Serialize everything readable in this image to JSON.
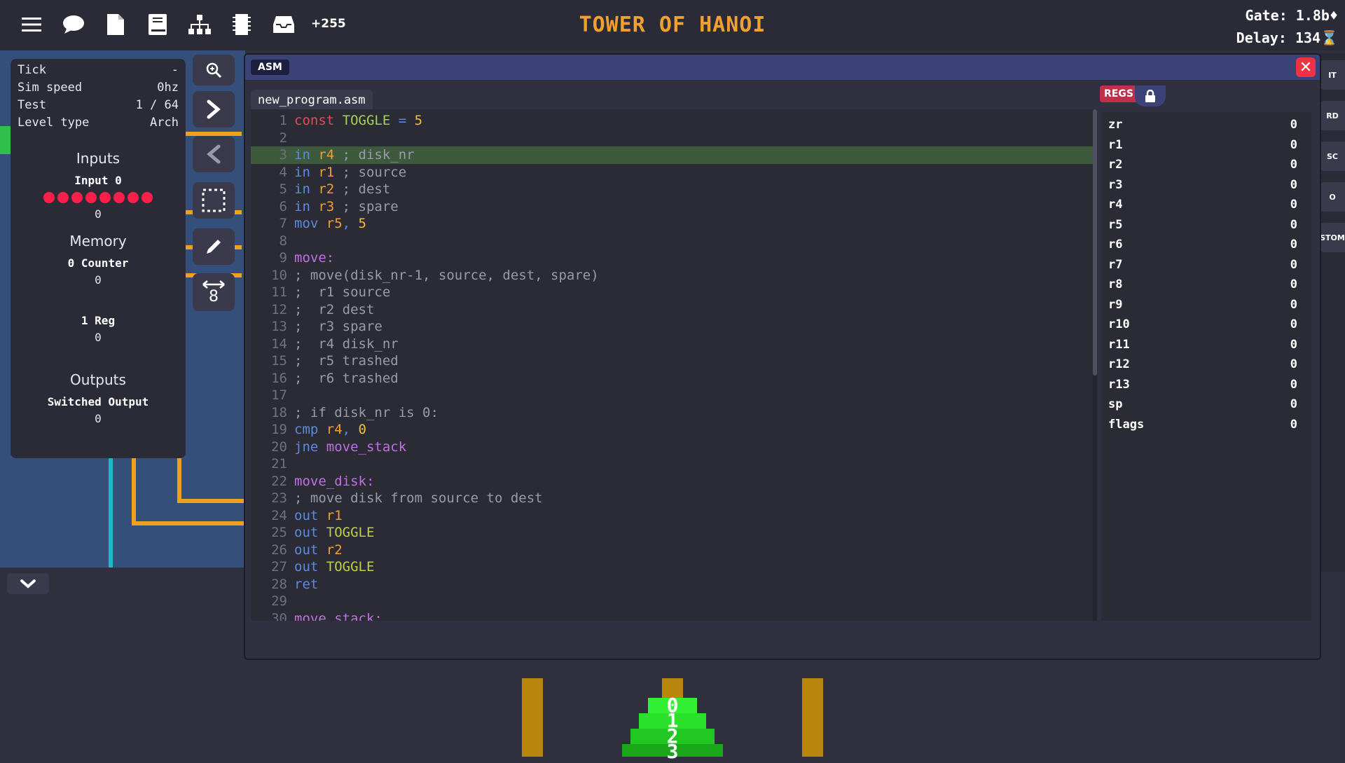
{
  "topbar": {
    "menu_icon": "hamburger-icon",
    "chat_icon": "speech-bubble-icon",
    "file_icon": "document-icon",
    "book_icon": "book-icon",
    "hierarchy_icon": "hierarchy-icon",
    "chip_icon": "chip-icon",
    "inbox_icon": "inbox-icon",
    "extra_count": "+255",
    "title": "TOWER OF HANOI",
    "gate": "Gate: 1.8b",
    "delay": "Delay: 134"
  },
  "info": {
    "tick_label": "Tick",
    "tick_value": "-",
    "speed_label": "Sim speed",
    "speed_value": "0hz",
    "test_label": "Test",
    "test_value": "1 / 64",
    "level_label": "Level type",
    "level_value": "Arch",
    "inputs_title": "Inputs",
    "input0_label": "Input 0",
    "input0_value": "0",
    "input_bits": 8,
    "memory_title": "Memory",
    "counter_label": "0 Counter",
    "counter_value": "0",
    "reg_label": "1 Reg",
    "reg_value": "0",
    "outputs_title": "Outputs",
    "switched_label": "Switched Output",
    "switched_value": "0"
  },
  "tools": {
    "zoom_icon": "zoom-icon",
    "next_icon": "chevron-right-icon",
    "prev_icon": "chevron-left-icon",
    "select_icon": "selection-icon",
    "pencil_icon": "pencil-icon",
    "width_value": "8"
  },
  "asm": {
    "badge": "ASM",
    "close": "✕",
    "filename": "new_program.asm",
    "regs_badge": "REGS",
    "lines": [
      {
        "n": "1",
        "tokens": [
          [
            "kw",
            "const "
          ],
          [
            "name",
            "TOGGLE "
          ],
          [
            "op",
            "= "
          ],
          [
            "num",
            "5"
          ]
        ]
      },
      {
        "n": "2",
        "tokens": []
      },
      {
        "n": "3",
        "tokens": [
          [
            "ins",
            "in "
          ],
          [
            "reg",
            "r4 "
          ],
          [
            "comment",
            "; disk_nr"
          ]
        ],
        "active": true
      },
      {
        "n": "4",
        "tokens": [
          [
            "ins",
            "in "
          ],
          [
            "reg",
            "r1 "
          ],
          [
            "comment",
            "; source"
          ]
        ]
      },
      {
        "n": "5",
        "tokens": [
          [
            "ins",
            "in "
          ],
          [
            "reg",
            "r2 "
          ],
          [
            "comment",
            "; dest"
          ]
        ]
      },
      {
        "n": "6",
        "tokens": [
          [
            "ins",
            "in "
          ],
          [
            "reg",
            "r3 "
          ],
          [
            "comment",
            "; spare"
          ]
        ]
      },
      {
        "n": "7",
        "tokens": [
          [
            "ins",
            "mov "
          ],
          [
            "reg",
            "r5"
          ],
          [
            "op",
            ", "
          ],
          [
            "num",
            "5"
          ]
        ]
      },
      {
        "n": "8",
        "tokens": []
      },
      {
        "n": "9",
        "tokens": [
          [
            "label",
            "move:"
          ]
        ]
      },
      {
        "n": "10",
        "tokens": [
          [
            "comment",
            "; move(disk_nr-1, source, dest, spare)"
          ]
        ]
      },
      {
        "n": "11",
        "tokens": [
          [
            "comment",
            ";  r1 source"
          ]
        ]
      },
      {
        "n": "12",
        "tokens": [
          [
            "comment",
            ";  r2 dest"
          ]
        ]
      },
      {
        "n": "13",
        "tokens": [
          [
            "comment",
            ";  r3 spare"
          ]
        ]
      },
      {
        "n": "14",
        "tokens": [
          [
            "comment",
            ";  r4 disk_nr"
          ]
        ]
      },
      {
        "n": "15",
        "tokens": [
          [
            "comment",
            ";  r5 trashed"
          ]
        ]
      },
      {
        "n": "16",
        "tokens": [
          [
            "comment",
            ";  r6 trashed"
          ]
        ]
      },
      {
        "n": "17",
        "tokens": []
      },
      {
        "n": "18",
        "tokens": [
          [
            "comment",
            "; if disk_nr is 0:"
          ]
        ]
      },
      {
        "n": "19",
        "tokens": [
          [
            "ins",
            "cmp "
          ],
          [
            "reg",
            "r4"
          ],
          [
            "op",
            ", "
          ],
          [
            "num",
            "0"
          ]
        ]
      },
      {
        "n": "20",
        "tokens": [
          [
            "ins",
            "jne "
          ],
          [
            "label",
            "move_stack"
          ]
        ]
      },
      {
        "n": "21",
        "tokens": []
      },
      {
        "n": "22",
        "tokens": [
          [
            "label",
            "move_disk:"
          ]
        ]
      },
      {
        "n": "23",
        "tokens": [
          [
            "comment",
            "; move disk from source to dest"
          ]
        ]
      },
      {
        "n": "24",
        "tokens": [
          [
            "ins",
            "out "
          ],
          [
            "reg",
            "r1"
          ]
        ]
      },
      {
        "n": "25",
        "tokens": [
          [
            "ins",
            "out "
          ],
          [
            "const",
            "TOGGLE"
          ]
        ]
      },
      {
        "n": "26",
        "tokens": [
          [
            "ins",
            "out "
          ],
          [
            "reg",
            "r2"
          ]
        ]
      },
      {
        "n": "27",
        "tokens": [
          [
            "ins",
            "out "
          ],
          [
            "const",
            "TOGGLE"
          ]
        ]
      },
      {
        "n": "28",
        "tokens": [
          [
            "ins",
            "ret"
          ]
        ]
      },
      {
        "n": "29",
        "tokens": []
      },
      {
        "n": "30",
        "tokens": [
          [
            "label",
            "move_stack:"
          ]
        ]
      }
    ],
    "registers": [
      {
        "name": "zr",
        "value": "0"
      },
      {
        "name": "r1",
        "value": "0"
      },
      {
        "name": "r2",
        "value": "0"
      },
      {
        "name": "r3",
        "value": "0"
      },
      {
        "name": "r4",
        "value": "0"
      },
      {
        "name": "r5",
        "value": "0"
      },
      {
        "name": "r6",
        "value": "0"
      },
      {
        "name": "r7",
        "value": "0"
      },
      {
        "name": "r8",
        "value": "0"
      },
      {
        "name": "r9",
        "value": "0"
      },
      {
        "name": "r10",
        "value": "0"
      },
      {
        "name": "r11",
        "value": "0"
      },
      {
        "name": "r12",
        "value": "0"
      },
      {
        "name": "r13",
        "value": "0"
      },
      {
        "name": "sp",
        "value": "0"
      },
      {
        "name": "flags",
        "value": "0"
      }
    ]
  },
  "right_tabs": [
    "IT",
    "RD",
    "SC",
    "O",
    "STOM"
  ],
  "tower": {
    "disks": [
      "0",
      "1",
      "2",
      "3"
    ]
  },
  "colors": {
    "accent": "#f0a030",
    "bit_on": "#ff1f4b",
    "disk_green": "#22c822",
    "pole": "#b8860b"
  }
}
